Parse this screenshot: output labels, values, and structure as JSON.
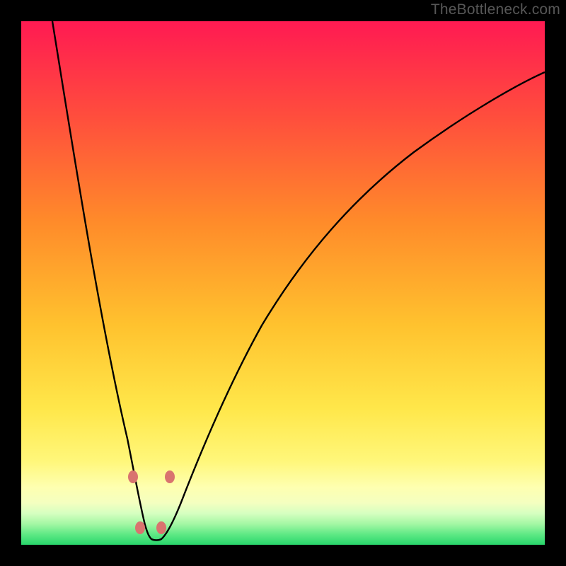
{
  "watermark": "TheBottleneck.com",
  "colors": {
    "frame": "#000000",
    "gradient_top": "#ff1a52",
    "gradient_mid1": "#ff7a2f",
    "gradient_mid2": "#ffd93a",
    "gradient_mid3": "#fff57a",
    "gradient_bottom_band": "#f3ffb5",
    "gradient_bottom": "#2fe27a",
    "curve": "#000000",
    "markers": "#d9736f"
  },
  "chart_data": {
    "type": "line",
    "title": "",
    "xlabel": "",
    "ylabel": "",
    "xlim": [
      0,
      100
    ],
    "ylim": [
      0,
      100
    ],
    "note": "Single V-shaped bottleneck curve; y is an approximate dissimilarity/bottleneck score (0 at the minimum, 100 at the top of the plot). x is a normalized parameter sweep. Values estimated from pixels.",
    "series": [
      {
        "name": "bottleneck-curve",
        "x": [
          6,
          8,
          10,
          12,
          14,
          16,
          18,
          20,
          21,
          22,
          23,
          24,
          25,
          26,
          27,
          28,
          30,
          32,
          35,
          40,
          45,
          50,
          55,
          60,
          65,
          70,
          75,
          80,
          85,
          90,
          95,
          100
        ],
        "y": [
          100,
          90,
          80,
          69,
          58,
          47,
          35,
          22,
          15,
          9,
          4,
          0,
          0,
          0,
          4,
          9,
          18,
          27,
          37,
          49,
          57,
          63,
          68,
          72,
          76,
          79,
          82,
          84,
          86,
          88,
          89,
          90
        ]
      }
    ],
    "markers": [
      {
        "x": 21.3,
        "y": 13
      },
      {
        "x": 22.7,
        "y": 3
      },
      {
        "x": 26.8,
        "y": 3
      },
      {
        "x": 28.3,
        "y": 13
      }
    ]
  }
}
